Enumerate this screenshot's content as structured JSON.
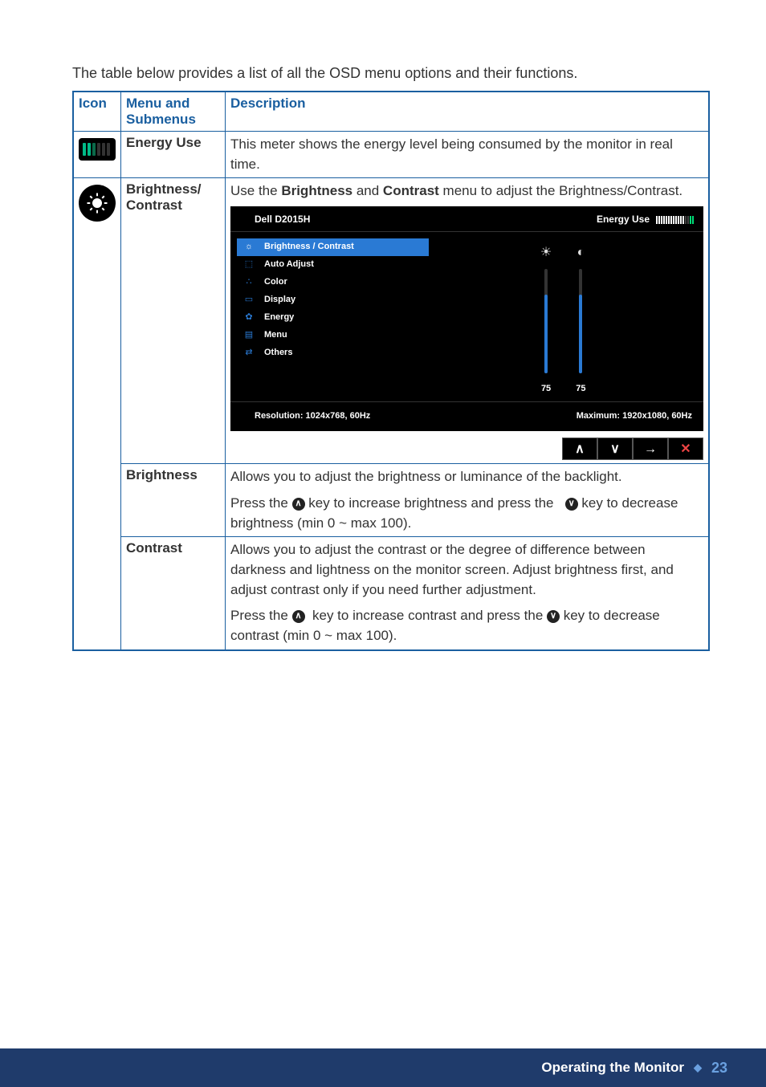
{
  "intro": "The table below provides a list of all the OSD menu options and their functions.",
  "headers": {
    "icon": "Icon",
    "menu": "Menu and Submenus",
    "desc": "Description"
  },
  "rows": {
    "energy": {
      "label": "Energy Use",
      "desc": "This meter shows the energy level being consumed by the monitor in real time."
    },
    "bc": {
      "label": "Brightness/ Contrast",
      "desc_before": "Use the ",
      "b1": "Brightness",
      "mid": " and ",
      "b2": "Contrast",
      "desc_after": " menu to adjust the Brightness/Contrast."
    },
    "brightness": {
      "label": "Brightness",
      "p1": "Allows you to adjust the brightness or luminance of the backlight.",
      "p2a": "Press the ",
      "p2b": " key to increase brightness and press the ",
      "p2c": " key to decrease brightness (min 0 ~ max 100)."
    },
    "contrast": {
      "label": "Contrast",
      "p1": "Allows you to adjust the contrast or the degree of difference between darkness and lightness on the monitor screen. Adjust brightness first, and adjust contrast only if you need further adjustment.",
      "p2a": "Press the ",
      "p2b": " key to increase contrast and press the ",
      "p2c": " key to decrease contrast (min 0 ~ max 100)."
    }
  },
  "osd": {
    "title": "Dell D2015H",
    "energy_label": "Energy Use",
    "menu": [
      "Brightness / Contrast",
      "Auto Adjust",
      "Color",
      "Display",
      "Energy",
      "Menu",
      "Others"
    ],
    "brightness_val": "75",
    "contrast_val": "75",
    "resolution": "Resolution: 1024x768, 60Hz",
    "max": "Maximum: 1920x1080, 60Hz"
  },
  "footer": {
    "title": "Operating the Monitor",
    "page": "23"
  }
}
